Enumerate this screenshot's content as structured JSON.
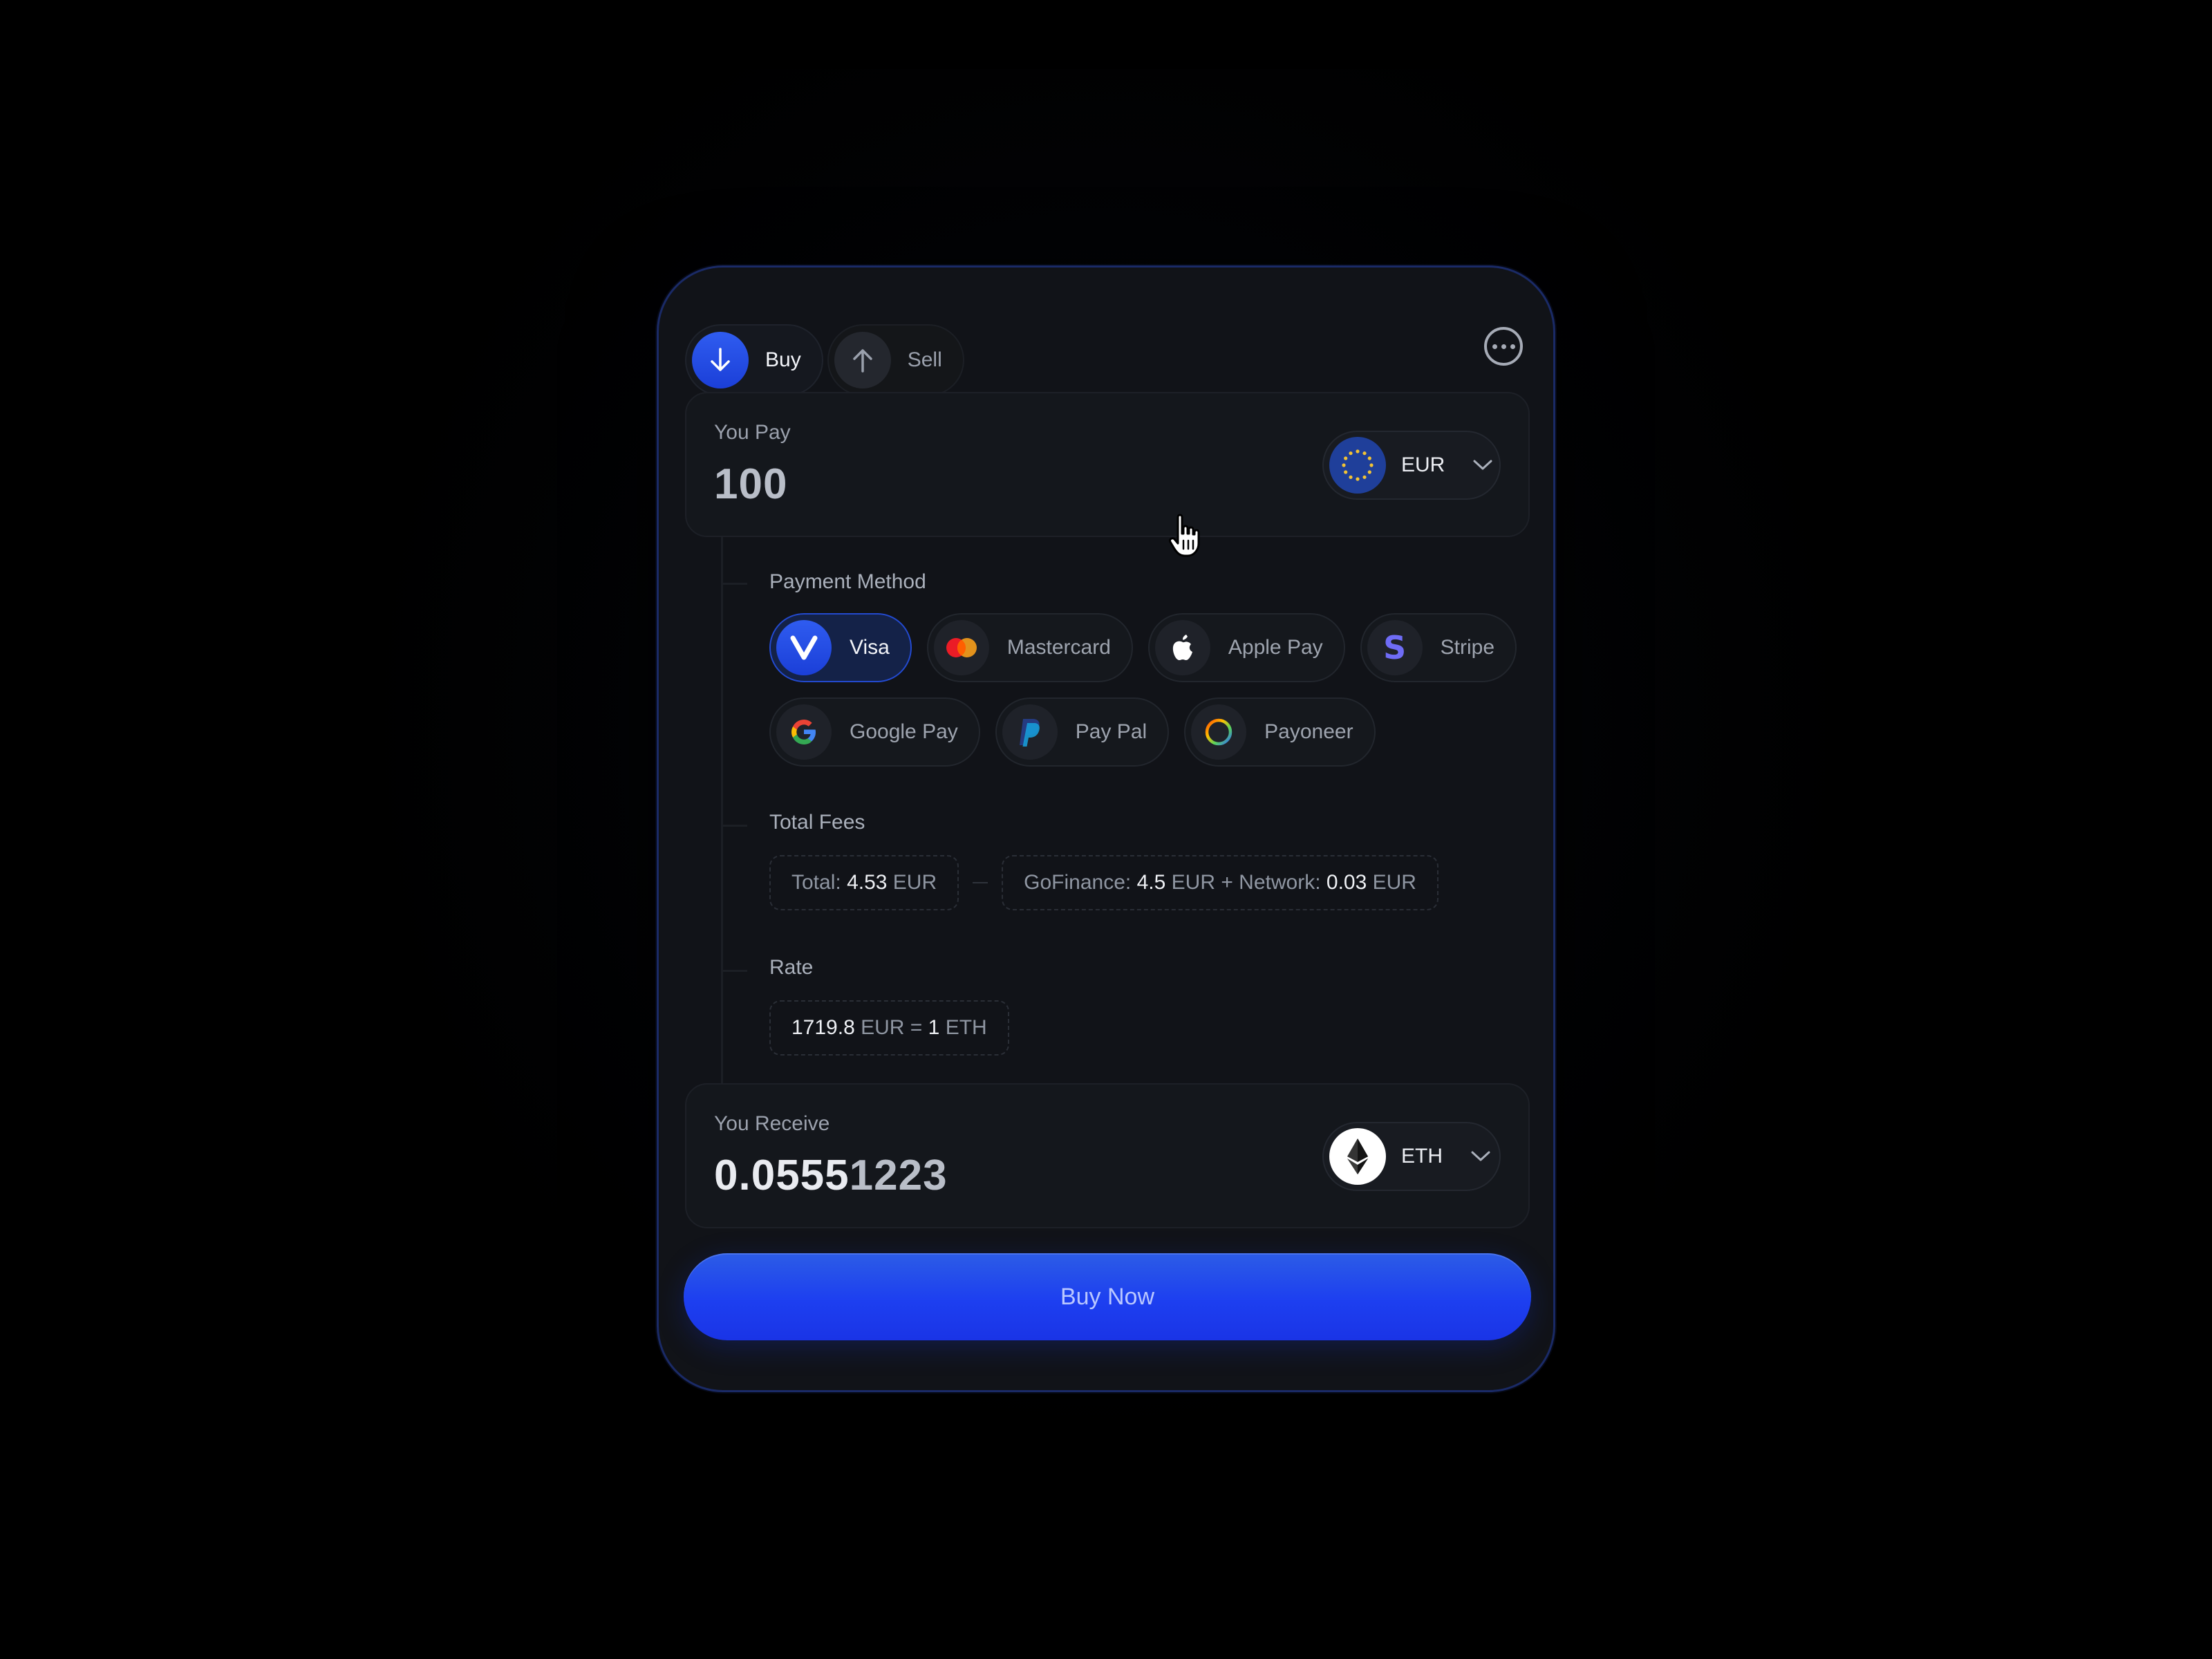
{
  "tabs": [
    {
      "label": "Buy",
      "active": true,
      "icon": "arrow-down-icon"
    },
    {
      "label": "Sell",
      "active": false,
      "icon": "arrow-up-icon"
    }
  ],
  "menu_icon": "more-horizontal-icon",
  "pay": {
    "label": "You Pay",
    "amount": "100",
    "currency": "EUR",
    "currency_icon": "eu-flag-icon"
  },
  "payment": {
    "label": "Payment Method",
    "methods": [
      {
        "label": "Visa",
        "icon": "visa-icon",
        "selected": true
      },
      {
        "label": "Mastercard",
        "icon": "mastercard-icon",
        "selected": false
      },
      {
        "label": "Apple Pay",
        "icon": "apple-icon",
        "selected": false
      },
      {
        "label": "Stripe",
        "icon": "stripe-icon",
        "selected": false
      },
      {
        "label": "Google Pay",
        "icon": "google-icon",
        "selected": false
      },
      {
        "label": "Pay Pal",
        "icon": "paypal-icon",
        "selected": false
      },
      {
        "label": "Payoneer",
        "icon": "payoneer-icon",
        "selected": false
      }
    ]
  },
  "fees": {
    "label": "Total Fees",
    "total_prefix": "Total:",
    "total_value": "4.53",
    "total_unit": "EUR",
    "gofinance_prefix": "GoFinance:",
    "gofinance_value": "4.5",
    "gofinance_unit": "EUR",
    "network_prefix": "+ Network:",
    "network_value": "0.03",
    "network_unit": "EUR"
  },
  "rate": {
    "label": "Rate",
    "from_value": "1719.8",
    "from_unit": "EUR",
    "equals": "=",
    "to_value": "1",
    "to_unit": "ETH"
  },
  "receive": {
    "label": "You Receive",
    "amount_strong": "0.0555",
    "amount_faded": "1223",
    "currency": "ETH",
    "currency_icon": "ethereum-icon"
  },
  "cta": {
    "label": "Buy Now"
  },
  "colors": {
    "accent": "#1d3ff0",
    "card_bg": "#111318",
    "page_bg": "#000000"
  }
}
